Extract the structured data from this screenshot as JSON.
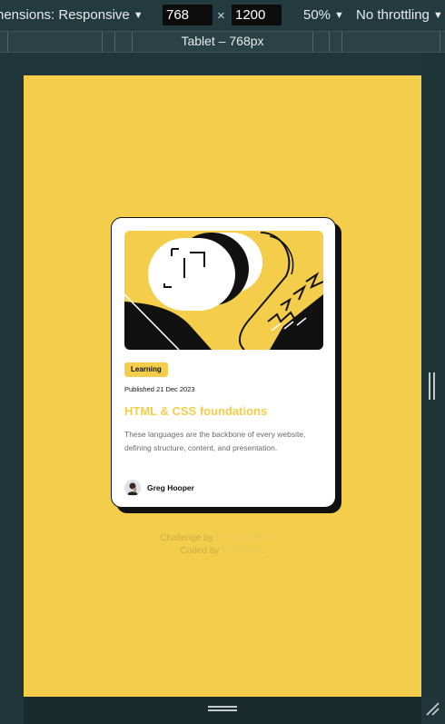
{
  "toolbar": {
    "dimensions_label": "nensions: Responsive",
    "width_value": "768",
    "height_value": "1200",
    "times": "×",
    "zoom": "50%",
    "throttle": "No throttling"
  },
  "media_bar": {
    "label": "Tablet – 768px"
  },
  "card": {
    "tag": "Learning",
    "published": "Published 21 Dec 2023",
    "title": "HTML & CSS foundations",
    "description": "These languages are the backbone of every website, defining structure, content, and presentation.",
    "author": "Greg Hooper"
  },
  "attribution": {
    "line1_prefix": "Challenge by ",
    "line1_link": "Frontend Mentor",
    "line1_suffix": ".",
    "line2_prefix": "Coded by ",
    "line2_link": "M. Slazon",
    "line2_suffix": "."
  },
  "colors": {
    "page_background": "#f4ce4b",
    "accent": "#f4ce4b",
    "card_background": "#ffffff",
    "card_border_shadow": "#111111",
    "devtools_background": "#233a3e"
  }
}
